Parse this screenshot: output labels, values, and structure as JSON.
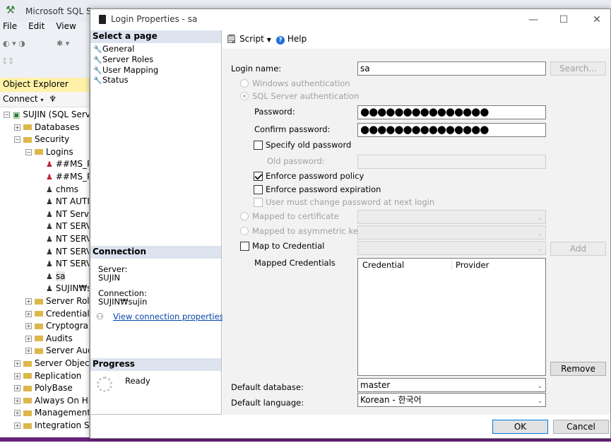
{
  "background": {
    "app_title": "Microsoft SQL Se",
    "menu": [
      "File",
      "Edit",
      "View"
    ],
    "object_explorer": {
      "title": "Object Explorer",
      "connect_label": "Connect",
      "server_node": "SUJIN (SQL Serve",
      "nodes": [
        {
          "label": "Databases",
          "type": "folder",
          "level": 1,
          "expander": "+"
        },
        {
          "label": "Security",
          "type": "folder",
          "level": 1,
          "expander": "−"
        },
        {
          "label": "Logins",
          "type": "folder",
          "level": 2,
          "expander": "−"
        },
        {
          "label": "##MS_P",
          "type": "login-disabled",
          "level": 3
        },
        {
          "label": "##MS_P",
          "type": "login-disabled",
          "level": 3
        },
        {
          "label": "chms",
          "type": "login",
          "level": 3
        },
        {
          "label": "NT AUTI",
          "type": "login",
          "level": 3
        },
        {
          "label": "NT Servi",
          "type": "login",
          "level": 3
        },
        {
          "label": "NT SERV",
          "type": "login",
          "level": 3
        },
        {
          "label": "NT SERV",
          "type": "login",
          "level": 3
        },
        {
          "label": "NT SERV",
          "type": "login",
          "level": 3
        },
        {
          "label": "NT SERV",
          "type": "login",
          "level": 3
        },
        {
          "label": "sa",
          "type": "login",
          "level": 3
        },
        {
          "label": "SUJIN₩s",
          "type": "login",
          "level": 3
        },
        {
          "label": "Server Role",
          "type": "folder",
          "level": 2,
          "expander": "+"
        },
        {
          "label": "Credentials",
          "type": "folder",
          "level": 2,
          "expander": "+"
        },
        {
          "label": "Cryptograp",
          "type": "folder",
          "level": 2,
          "expander": "+"
        },
        {
          "label": "Audits",
          "type": "folder",
          "level": 2,
          "expander": "+"
        },
        {
          "label": "Server Aud",
          "type": "folder",
          "level": 2,
          "expander": "+"
        },
        {
          "label": "Server Objects",
          "type": "folder",
          "level": 1,
          "expander": "+"
        },
        {
          "label": "Replication",
          "type": "folder",
          "level": 1,
          "expander": "+"
        },
        {
          "label": "PolyBase",
          "type": "folder",
          "level": 1,
          "expander": "+"
        },
        {
          "label": "Always On Hi",
          "type": "folder",
          "level": 1,
          "expander": "+"
        },
        {
          "label": "Management",
          "type": "folder",
          "level": 1,
          "expander": "+"
        },
        {
          "label": "Integration Se",
          "type": "folder",
          "level": 1,
          "expander": "+"
        }
      ]
    }
  },
  "dialog": {
    "title": "Login Properties - sa",
    "window_controls": {
      "minimize": "—",
      "maximize": "☐",
      "close": "✕"
    },
    "select_page": {
      "heading": "Select a page",
      "items": [
        "General",
        "Server Roles",
        "User Mapping",
        "Status"
      ]
    },
    "connection": {
      "heading": "Connection",
      "server_label": "Server:",
      "server_value": "SUJIN",
      "connection_label": "Connection:",
      "connection_value": "SUJIN₩sujin",
      "view_link": "View connection properties"
    },
    "progress": {
      "heading": "Progress",
      "status": "Ready"
    },
    "toolbar": {
      "script_label": "Script",
      "help_label": "Help"
    },
    "form": {
      "login_name_label": "Login name:",
      "login_name_value": "sa",
      "search_button": "Search...",
      "windows_auth_label": "Windows authentication",
      "sql_auth_label": "SQL Server authentication",
      "password_label": "Password:",
      "password_value": "●●●●●●●●●●●●●●●",
      "confirm_password_label": "Confirm password:",
      "confirm_password_value": "●●●●●●●●●●●●●●●",
      "specify_old_password_label": "Specify old password",
      "old_password_label": "Old password:",
      "enforce_policy_label": "Enforce password policy",
      "enforce_policy_checked": true,
      "enforce_expiration_label": "Enforce password expiration",
      "enforce_expiration_checked": false,
      "must_change_label": "User must change password at next login",
      "mapped_cert_label": "Mapped to certificate",
      "mapped_asym_label": "Mapped to asymmetric key",
      "map_credential_label": "Map to Credential",
      "add_button": "Add",
      "mapped_credentials_label": "Mapped Credentials",
      "credentials_columns": [
        "Credential",
        "Provider"
      ],
      "remove_button": "Remove",
      "default_database_label": "Default database:",
      "default_database_value": "master",
      "default_language_label": "Default language:",
      "default_language_value": "Korean - 한국어"
    },
    "ok_button": "OK",
    "cancel_button": "Cancel"
  },
  "colors": {
    "section_header": "#dde3ef",
    "status_bar": "#68217a",
    "link": "#0645ad"
  }
}
